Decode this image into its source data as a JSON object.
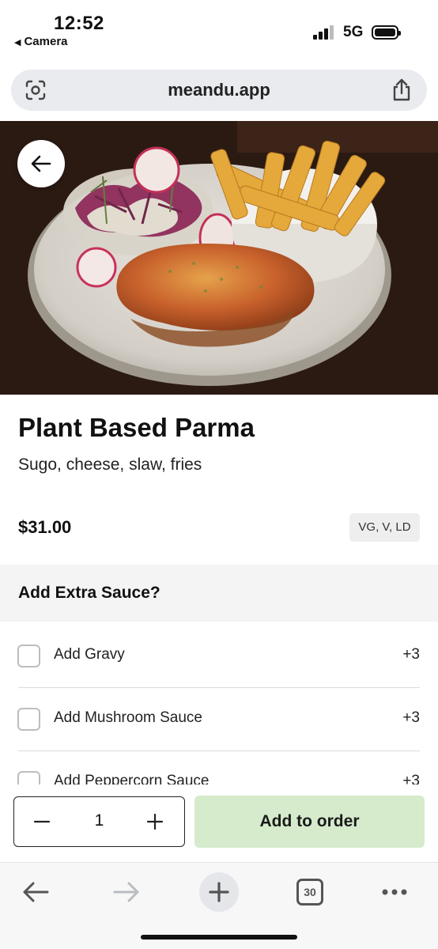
{
  "status_bar": {
    "time": "12:52",
    "back_app": "Camera",
    "network": "5G"
  },
  "browser": {
    "url": "meandu.app",
    "tab_count": "30"
  },
  "item": {
    "name": "Plant Based Parma",
    "description": "Sugo, cheese, slaw, fries",
    "price": "$31.00",
    "dietary": "VG, V, LD"
  },
  "modifier_group": {
    "title": "Add Extra Sauce?",
    "options": [
      {
        "label": "Add Gravy",
        "price": "+3"
      },
      {
        "label": "Add Mushroom Sauce",
        "price": "+3"
      },
      {
        "label": "Add Peppercorn Sauce",
        "price": "+3"
      }
    ]
  },
  "order_bar": {
    "quantity": "1",
    "add_label": "Add to order"
  },
  "colors": {
    "add_button_bg": "#d5ebcc",
    "section_bg": "#f4f4f4"
  }
}
